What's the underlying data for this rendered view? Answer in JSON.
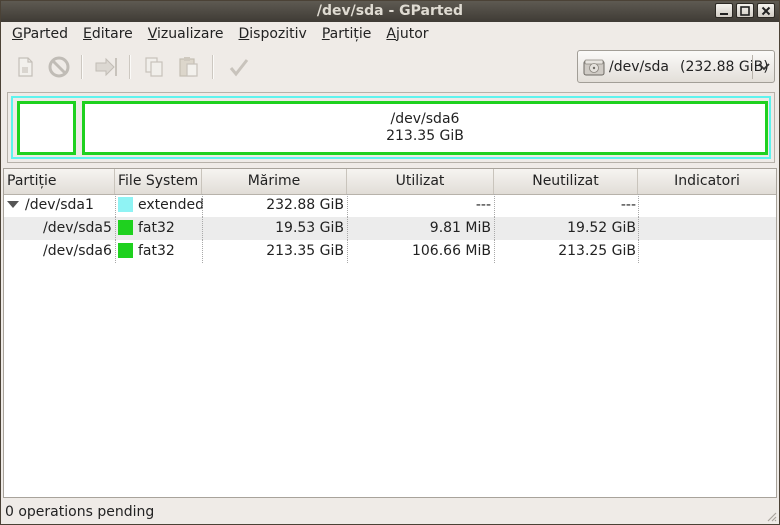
{
  "window": {
    "title": "/dev/sda - GParted"
  },
  "menubar": {
    "items": [
      {
        "mnemonic": "G",
        "rest": "Parted"
      },
      {
        "mnemonic": "E",
        "rest": "ditare"
      },
      {
        "mnemonic": "V",
        "rest": "izualizare"
      },
      {
        "mnemonic": "D",
        "rest": "ispozitiv"
      },
      {
        "mnemonic": "P",
        "rest": "artiție"
      },
      {
        "mnemonic": "A",
        "rest": "jutor"
      }
    ]
  },
  "toolbar": {
    "buttons": [
      "new-partition-icon",
      "delete-icon",
      "resize-move-icon",
      "copy-icon",
      "paste-icon",
      "apply-icon"
    ],
    "device": {
      "name": "/dev/sda",
      "size": "(232.88 GiB)"
    }
  },
  "partition_map": {
    "selected": {
      "name": "/dev/sda6",
      "size": "213.35 GiB"
    },
    "colors": {
      "extended": "#5ef3ee",
      "fat32": "#1fd11f"
    }
  },
  "table": {
    "columns": [
      "Partiție",
      "File System",
      "Mărime",
      "Utilizat",
      "Neutilizat",
      "Indicatori"
    ],
    "rows": [
      {
        "partition": "/dev/sda1",
        "fs": "extended",
        "fs_color": "#8ff3f4",
        "size": "232.88 GiB",
        "used": "---",
        "unused": "---",
        "flags": "",
        "expanded": true
      },
      {
        "partition": "/dev/sda5",
        "fs": "fat32",
        "fs_color": "#1fd11f",
        "size": "19.53 GiB",
        "used": "9.81 MiB",
        "unused": "19.52 GiB",
        "flags": ""
      },
      {
        "partition": "/dev/sda6",
        "fs": "fat32",
        "fs_color": "#1fd11f",
        "size": "213.35 GiB",
        "used": "106.66 MiB",
        "unused": "213.25 GiB",
        "flags": ""
      }
    ]
  },
  "statusbar": {
    "text": "0 operations pending"
  }
}
